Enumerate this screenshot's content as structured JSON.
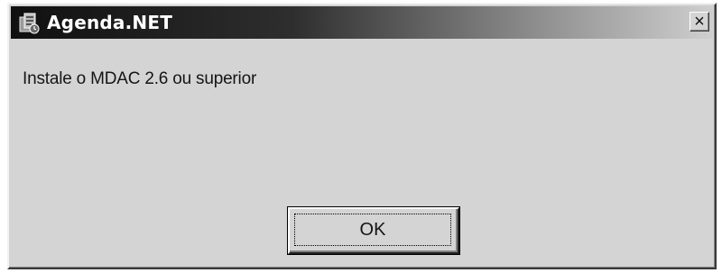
{
  "window": {
    "title": "Agenda.NET",
    "icon": "agenda-app-icon",
    "close_label": "×"
  },
  "dialog": {
    "message": "Instale o MDAC 2.6 ou superior",
    "ok_label": "OK"
  },
  "colors": {
    "titlebar_start": "#101010",
    "titlebar_end": "#cfcfcf",
    "dialog_background": "#d4d4d4"
  }
}
